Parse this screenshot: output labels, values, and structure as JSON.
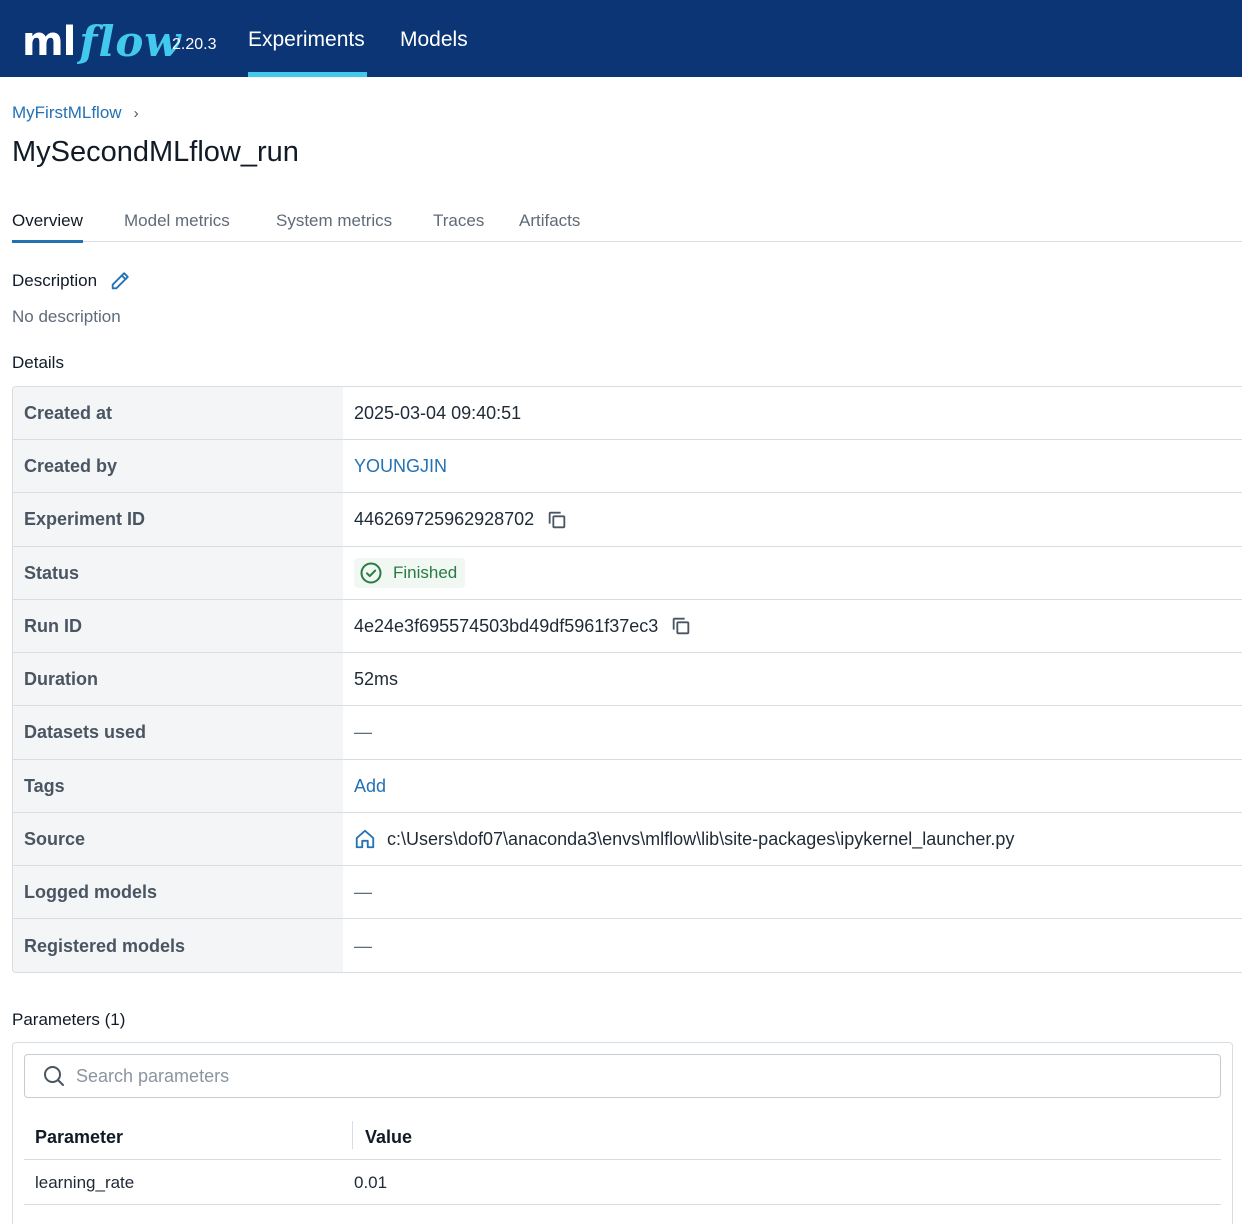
{
  "header": {
    "logo_ml": "ml",
    "logo_flow": "flow",
    "version": "2.20.3",
    "nav": [
      {
        "label": "Experiments",
        "active": true
      },
      {
        "label": "Models",
        "active": false
      }
    ],
    "colors": {
      "background": "#0b3574",
      "accent": "#43c9ed"
    }
  },
  "breadcrumb": {
    "experiment": "MyFirstMLflow",
    "separator": "›"
  },
  "page_title": "MySecondMLflow_run",
  "tabs": [
    {
      "label": "Overview",
      "active": true
    },
    {
      "label": "Model metrics",
      "active": false
    },
    {
      "label": "System metrics",
      "active": false
    },
    {
      "label": "Traces",
      "active": false
    },
    {
      "label": "Artifacts",
      "active": false
    }
  ],
  "description": {
    "heading": "Description",
    "edit_icon": "pencil-icon",
    "text": "No description"
  },
  "details": {
    "heading": "Details",
    "rows": {
      "created_at": {
        "label": "Created at",
        "value": "2025-03-04 09:40:51"
      },
      "created_by": {
        "label": "Created by",
        "value": "YOUNGJIN"
      },
      "experiment_id": {
        "label": "Experiment ID",
        "value": "446269725962928702",
        "icon": "copy-icon"
      },
      "status": {
        "label": "Status",
        "value": "Finished",
        "icon": "check-circle-icon",
        "color": "#277c43"
      },
      "run_id": {
        "label": "Run ID",
        "value": "4e24e3f695574503bd49df5961f37ec3",
        "icon": "copy-icon"
      },
      "duration": {
        "label": "Duration",
        "value": "52ms"
      },
      "datasets_used": {
        "label": "Datasets used",
        "value": "—"
      },
      "tags": {
        "label": "Tags",
        "value": "Add"
      },
      "source": {
        "label": "Source",
        "value": "c:\\Users\\dof07\\anaconda3\\envs\\mlflow\\lib\\site-packages\\ipykernel_launcher.py",
        "icon": "home-icon"
      },
      "logged_models": {
        "label": "Logged models",
        "value": "—"
      },
      "registered_models": {
        "label": "Registered models",
        "value": "—"
      }
    }
  },
  "parameters": {
    "heading": "Parameters (1)",
    "search_placeholder": "Search parameters",
    "columns": {
      "parameter": "Parameter",
      "value": "Value"
    },
    "rows": [
      {
        "parameter": "learning_rate",
        "value": "0.01"
      }
    ]
  }
}
